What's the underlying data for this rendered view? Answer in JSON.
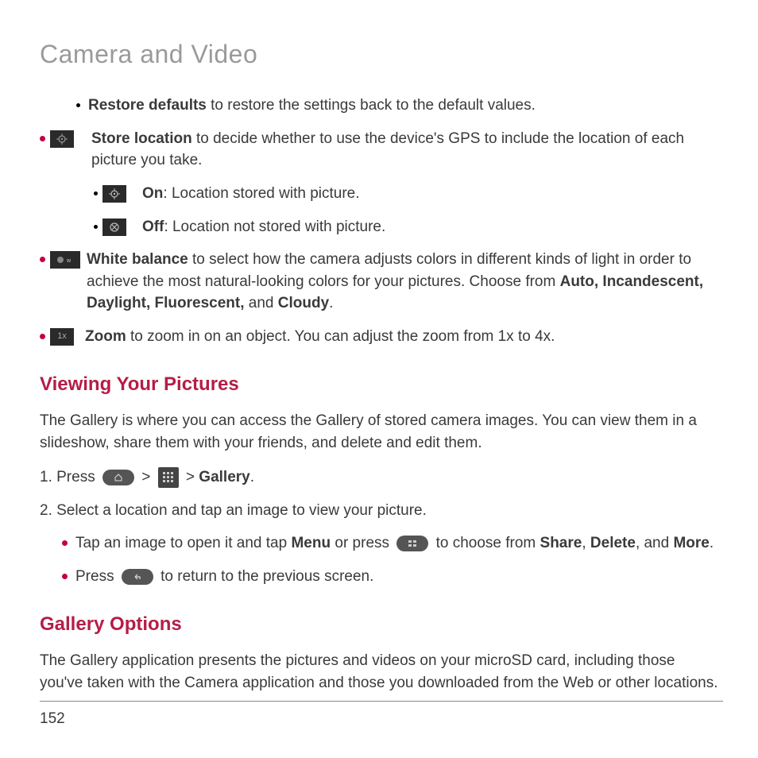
{
  "page": {
    "title": "Camera and Video",
    "number": "152"
  },
  "bullets": {
    "restore": {
      "label": "Restore defaults",
      "text": " to restore the settings back to the default values."
    },
    "store": {
      "label": "Store location",
      "text": " to decide whether to use the device's GPS to include the location of each picture you take."
    },
    "on": {
      "label": "On",
      "text": ": Location stored with picture."
    },
    "off": {
      "label": "Off",
      "text": ": Location not stored with picture."
    },
    "wb": {
      "label": "White balance",
      "text1": " to select how the camera adjusts colors in different kinds of light in order to achieve the most natural-looking colors for your pictures. Choose from ",
      "opts": "Auto, Incandescent, Daylight, Fluorescent,",
      "and": " and ",
      "last": "Cloudy",
      "dot": "."
    },
    "zoom": {
      "label": "Zoom",
      "text": " to zoom in on an object. You can adjust the zoom from 1x to 4x."
    }
  },
  "sections": {
    "viewing": {
      "heading": "Viewing Your Pictures",
      "intro": "The Gallery is where you can access the Gallery of stored camera images. You can view them in a slideshow, share them with your friends, and delete and edit them.",
      "step1_pre": "1.  Press ",
      "step1_sep": "  >  ",
      "step1_gallery": "Gallery",
      "step1_dot": ".",
      "step2": "2. Select a location and tap an image to view your picture.",
      "sub1_a": "Tap an image to open it and tap ",
      "sub1_menu": "Menu",
      "sub1_b": " or press ",
      "sub1_c": " to choose from ",
      "sub1_share": "Share",
      "sub1_comma1": ", ",
      "sub1_delete": "Delete",
      "sub1_comma2": ", and ",
      "sub1_more": "More",
      "sub1_dot": ".",
      "sub2_a": "Press ",
      "sub2_b": " to return to the previous screen."
    },
    "gallery": {
      "heading": "Gallery Options",
      "intro": "The Gallery application presents the pictures and videos on your microSD card, including those you've taken with the Camera application and those you downloaded from the Web or other locations."
    }
  },
  "icons": {
    "zoom_label": "1x"
  }
}
